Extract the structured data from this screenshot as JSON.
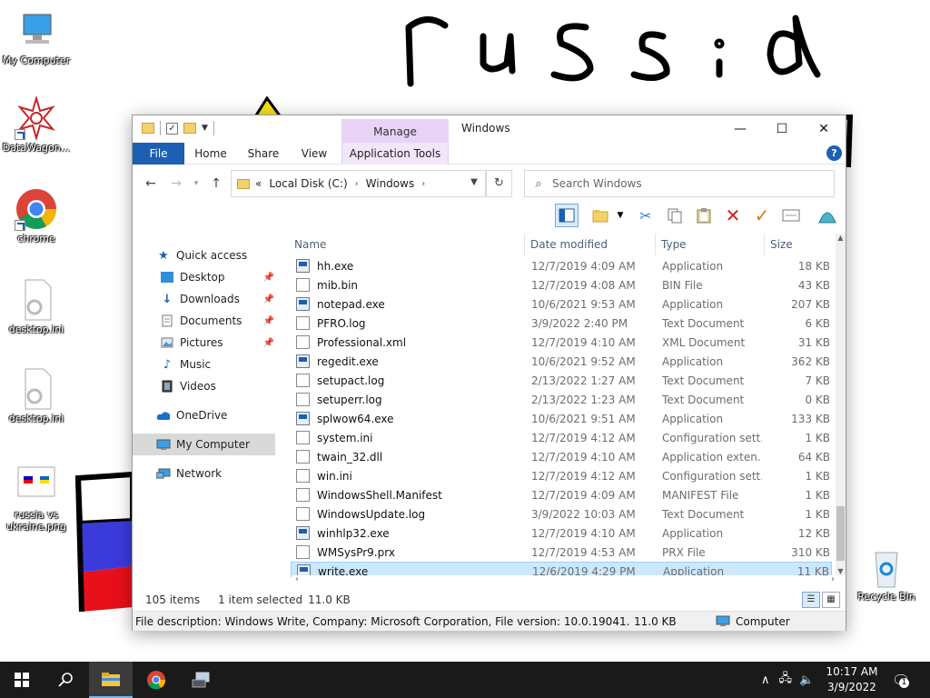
{
  "desktop": {
    "icons": [
      {
        "label": "My Computer"
      },
      {
        "label": "DataWagon..."
      },
      {
        "label": "chrome"
      },
      {
        "label": "desktop.ini"
      },
      {
        "label": "desktop.ini"
      },
      {
        "label": "russia vs ukraine.png"
      },
      {
        "label": "Recycle Bin"
      }
    ],
    "paint_text": "russia"
  },
  "window": {
    "title": "Windows",
    "manage_tab": "Manage",
    "tabs": [
      "File",
      "Home",
      "Share",
      "View",
      "Application Tools"
    ],
    "help": "?",
    "address": {
      "prefix": "«",
      "segments": [
        "Local Disk (C:)",
        "Windows"
      ]
    },
    "search_placeholder": "Search Windows",
    "nav": [
      {
        "label": "Quick access",
        "icon": "star-icon"
      },
      {
        "label": "Desktop",
        "icon": "desktop-folder-icon",
        "pinned": true
      },
      {
        "label": "Downloads",
        "icon": "download-icon",
        "pinned": true
      },
      {
        "label": "Documents",
        "icon": "documents-icon",
        "pinned": true
      },
      {
        "label": "Pictures",
        "icon": "pictures-icon",
        "pinned": true
      },
      {
        "label": "Music",
        "icon": "music-icon"
      },
      {
        "label": "Videos",
        "icon": "videos-icon"
      },
      {
        "label": "OneDrive",
        "icon": "cloud-icon"
      },
      {
        "label": "My Computer",
        "icon": "computer-icon"
      },
      {
        "label": "Network",
        "icon": "network-icon"
      }
    ],
    "columns": {
      "name": "Name",
      "date": "Date modified",
      "type": "Type",
      "size": "Size"
    },
    "files": [
      {
        "name": "hh.exe",
        "date": "12/7/2019 4:09 AM",
        "type": "Application",
        "size": "18 KB",
        "icon": "app"
      },
      {
        "name": "mib.bin",
        "date": "12/7/2019 4:08 AM",
        "type": "BIN File",
        "size": "43 KB",
        "icon": "doc"
      },
      {
        "name": "notepad.exe",
        "date": "10/6/2021 9:53 AM",
        "type": "Application",
        "size": "207 KB",
        "icon": "app"
      },
      {
        "name": "PFRO.log",
        "date": "3/9/2022 2:40 PM",
        "type": "Text Document",
        "size": "6 KB",
        "icon": "doc"
      },
      {
        "name": "Professional.xml",
        "date": "12/7/2019 4:10 AM",
        "type": "XML Document",
        "size": "31 KB",
        "icon": "doc"
      },
      {
        "name": "regedit.exe",
        "date": "10/6/2021 9:52 AM",
        "type": "Application",
        "size": "362 KB",
        "icon": "app"
      },
      {
        "name": "setupact.log",
        "date": "2/13/2022 1:27 AM",
        "type": "Text Document",
        "size": "7 KB",
        "icon": "doc"
      },
      {
        "name": "setuperr.log",
        "date": "2/13/2022 1:23 AM",
        "type": "Text Document",
        "size": "0 KB",
        "icon": "doc"
      },
      {
        "name": "splwow64.exe",
        "date": "10/6/2021 9:51 AM",
        "type": "Application",
        "size": "133 KB",
        "icon": "app"
      },
      {
        "name": "system.ini",
        "date": "12/7/2019 4:12 AM",
        "type": "Configuration sett...",
        "size": "1 KB",
        "icon": "doc"
      },
      {
        "name": "twain_32.dll",
        "date": "12/7/2019 4:10 AM",
        "type": "Application exten...",
        "size": "64 KB",
        "icon": "doc"
      },
      {
        "name": "win.ini",
        "date": "12/7/2019 4:12 AM",
        "type": "Configuration sett...",
        "size": "1 KB",
        "icon": "doc"
      },
      {
        "name": "WindowsShell.Manifest",
        "date": "12/7/2019 4:09 AM",
        "type": "MANIFEST File",
        "size": "1 KB",
        "icon": "doc"
      },
      {
        "name": "WindowsUpdate.log",
        "date": "3/9/2022 10:03 AM",
        "type": "Text Document",
        "size": "1 KB",
        "icon": "doc"
      },
      {
        "name": "winhlp32.exe",
        "date": "12/7/2019 4:10 AM",
        "type": "Application",
        "size": "12 KB",
        "icon": "app"
      },
      {
        "name": "WMSysPr9.prx",
        "date": "12/7/2019 4:53 AM",
        "type": "PRX File",
        "size": "310 KB",
        "icon": "doc"
      },
      {
        "name": "write.exe",
        "date": "12/6/2019 4:29 PM",
        "type": "Application",
        "size": "11 KB",
        "icon": "app",
        "selected": true
      }
    ],
    "status": {
      "items": "105 items",
      "selected": "1 item selected",
      "size": "11.0 KB"
    },
    "details": {
      "description": "File description: Windows Write, Company: Microsoft Corporation, File version: 10.0.19041.1, Date creat",
      "size": "11.0 KB",
      "location": "Computer"
    }
  },
  "taskbar": {
    "time": "10:17 AM",
    "date": "3/9/2022",
    "notifications": "1"
  }
}
